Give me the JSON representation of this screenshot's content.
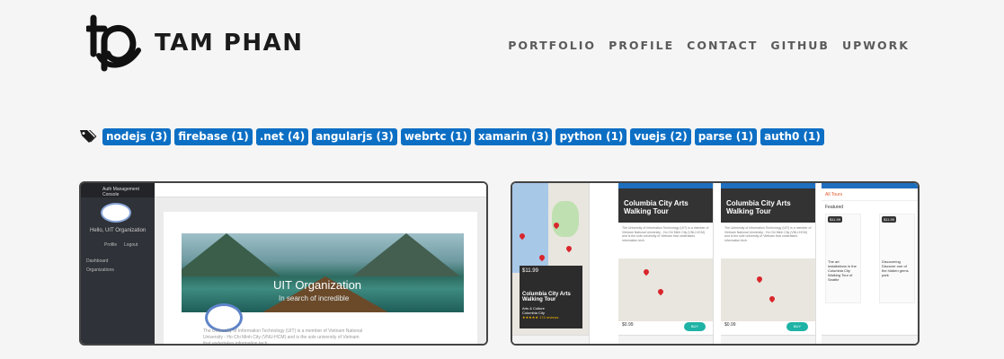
{
  "header": {
    "brand": "TAM PHAN",
    "nav": [
      "PORTFOLIO",
      "PROFILE",
      "CONTACT",
      "GITHUB",
      "UPWORK"
    ]
  },
  "tags": {
    "icon": "tags-icon",
    "items": [
      "nodejs (3)",
      "firebase (1)",
      ".net (4)",
      "angularjs (3)",
      "webrtc (1)",
      "xamarin (3)",
      "python (1)",
      "vuejs (2)",
      "parse (1)",
      "auth0 (1)"
    ]
  },
  "project1": {
    "sidebar_title": "Auth Management Console",
    "hello": "Hello, UIT Organization",
    "profile": "Profile",
    "logout": "Logout",
    "menu": [
      "Dashboard",
      "Organizations"
    ],
    "org_title": "UIT Organization",
    "org_subtitle": "In search of incredible",
    "org_text": "The University of Information Technology (UIT) is a member of Vietnam National University - Ho Chi Minh City (VNU-HCM) and is the sole university of Vietnam that undertakes information tech"
  },
  "project2": {
    "tour_title": "Columbia City Arts Walking Tour",
    "card_price": "$11.99",
    "card_title": "Columbia City Arts Walking Tour",
    "card_tag": "Arts & Culture",
    "card_loc": "Columbia City",
    "card_reviews": "★★★★★ 174 reviews",
    "price": "$0.99",
    "price_note": "for the whole tour",
    "buy": "BUY",
    "all_tours": "All Tours",
    "featured": "Featured",
    "mini_price": "$11.99",
    "mini_caption1": "The art installations in the Columbia City Walking Tour of Seattle",
    "mini_caption2": "Discovering Discover one of the hidden gems park",
    "colors": {
      "accent": "#0d6fc4",
      "buy": "#1fb3a6",
      "status": "#1f6fbf"
    }
  }
}
